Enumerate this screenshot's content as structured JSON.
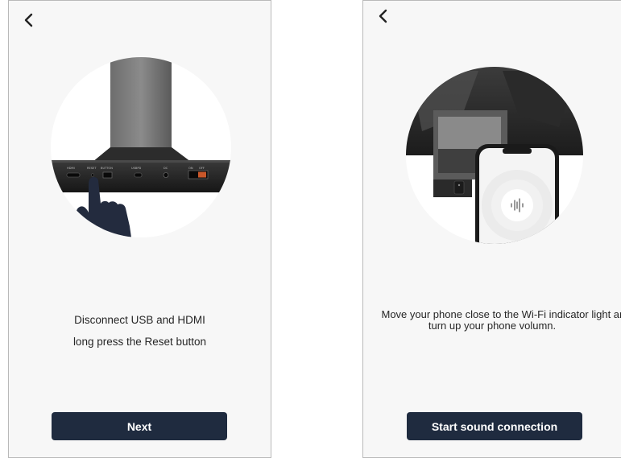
{
  "left_screen": {
    "back_icon": "chevron-left-icon",
    "device_port_labels": [
      "HDMI",
      "RESET",
      "BUTTON",
      "USBPD",
      "DC",
      "ON",
      "OFF"
    ],
    "instruction_line1": "Disconnect USB and HDMI",
    "instruction_line2": "long press the Reset button",
    "next_button_label": "Next"
  },
  "right_screen": {
    "back_icon": "chevron-left-icon",
    "phone_icon": "sound-wave-icon",
    "instruction_line1": "Move your phone close to the Wi-Fi indicator light and",
    "instruction_line2": "turn up your phone volumn.",
    "start_button_label": "Start sound connection"
  },
  "colors": {
    "button_bg": "#1f2b3f",
    "screen_bg": "#f7f7f7",
    "hand": "#232b3e"
  }
}
